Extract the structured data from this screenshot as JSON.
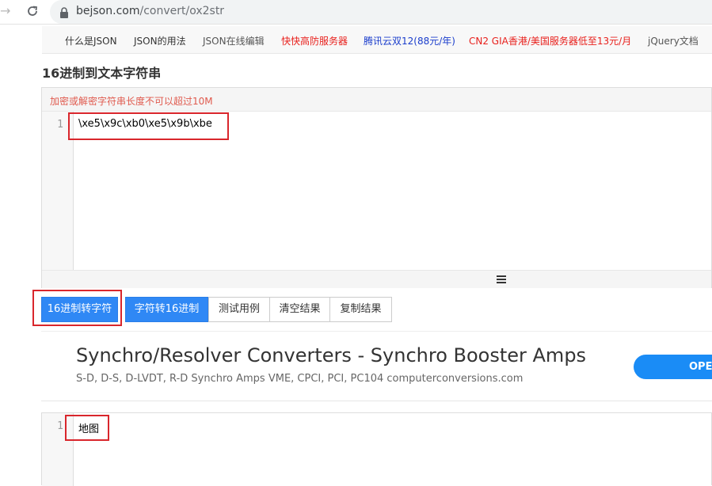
{
  "browser": {
    "url_host": "bejson.com",
    "url_path": "/convert/ox2str"
  },
  "site_nav": {
    "items": [
      {
        "label": "什么是JSON",
        "color": "#333333"
      },
      {
        "label": "JSON的用法",
        "color": "#333333"
      },
      {
        "label": "JSON在线编辑",
        "color": "#555555"
      },
      {
        "label": "快快高防服务器",
        "color": "#e8201c"
      },
      {
        "label": "腾讯云双12(88元/年)",
        "color": "#1a3dcc"
      },
      {
        "label": "CN2 GIA香港/美国服务器低至13元/月",
        "color": "#e8201c"
      },
      {
        "label": "jQuery文档",
        "color": "#555555"
      }
    ]
  },
  "page": {
    "title": "16进制到文本字符串"
  },
  "editor_input": {
    "warning": "加密或解密字符串长度不可以超过10M",
    "line_number": "1",
    "content": "\\xe5\\x9c\\xb0\\xe5\\x9b\\xbe"
  },
  "buttons": {
    "hex_to_str": "16进制转字符",
    "str_to_hex": "字符转16进制",
    "test_case": "测试用例",
    "clear": "清空结果",
    "copy": "复制结果"
  },
  "ad": {
    "title": "Synchro/Resolver Converters - Synchro Booster Amps",
    "description": "S-D, D-S, D-LVDT, R-D Synchro Amps VME, CPCI, PCI, PC104 computerconversions.com",
    "cta": "OPEN"
  },
  "editor_output": {
    "line_number": "1",
    "content": "地图"
  },
  "icons": {
    "forward": "forward-arrow-icon",
    "reload": "reload-icon",
    "lock": "lock-icon",
    "resize": "hamburger-resize-icon"
  },
  "colors": {
    "primary_button": "#2f88f5",
    "highlight": "#d9262c",
    "warning_text": "#e05a4e",
    "ad_button": "#1a8cf6"
  }
}
